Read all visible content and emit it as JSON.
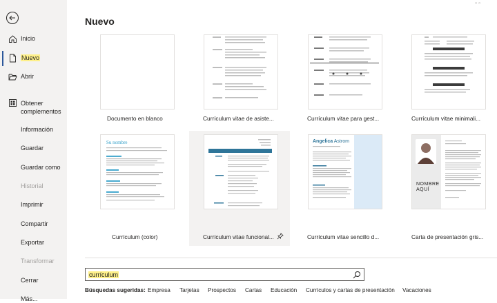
{
  "sidebar": {
    "items": [
      {
        "label": "Inicio",
        "icon": "home-icon"
      },
      {
        "label": "Nuevo",
        "icon": "new-file-icon"
      },
      {
        "label": "Abrir",
        "icon": "folder-open-icon"
      },
      {
        "label": "Obtener",
        "label2": "complementos",
        "icon": "addins-icon"
      },
      {
        "label": "Información"
      },
      {
        "label": "Guardar"
      },
      {
        "label": "Guardar como"
      },
      {
        "label": "Historial"
      },
      {
        "label": "Imprimir"
      },
      {
        "label": "Compartir"
      },
      {
        "label": "Exportar"
      },
      {
        "label": "Transformar"
      },
      {
        "label": "Cerrar"
      },
      {
        "label": "Más..."
      }
    ]
  },
  "main": {
    "title": "Nuevo",
    "templates": [
      {
        "name": "Documento en blanco"
      },
      {
        "name": "Currículum vitae de asiste..."
      },
      {
        "name": "Currículum vitae para gest..."
      },
      {
        "name": "Currículum vitae minimali..."
      },
      {
        "name": "Currículum (color)"
      },
      {
        "name": "Currículum vitae funcional..."
      },
      {
        "name": "Currículum vitae sencillo d..."
      },
      {
        "name": "Carta de presentación gris..."
      }
    ],
    "thumb_text": {
      "su_nombre": "Su nombre",
      "angelica": "Angelica",
      "astrom": "Astrom",
      "nombre": "NOMBRE",
      "aqui": "AQUÍ"
    },
    "search": {
      "value": "currículum"
    },
    "suggested": {
      "lead": "Búsquedas sugeridas:",
      "items": [
        "Empresa",
        "Tarjetas",
        "Prospectos",
        "Cartas",
        "Educación",
        "Currículos y cartas de presentación",
        "Vacaciones"
      ]
    }
  }
}
